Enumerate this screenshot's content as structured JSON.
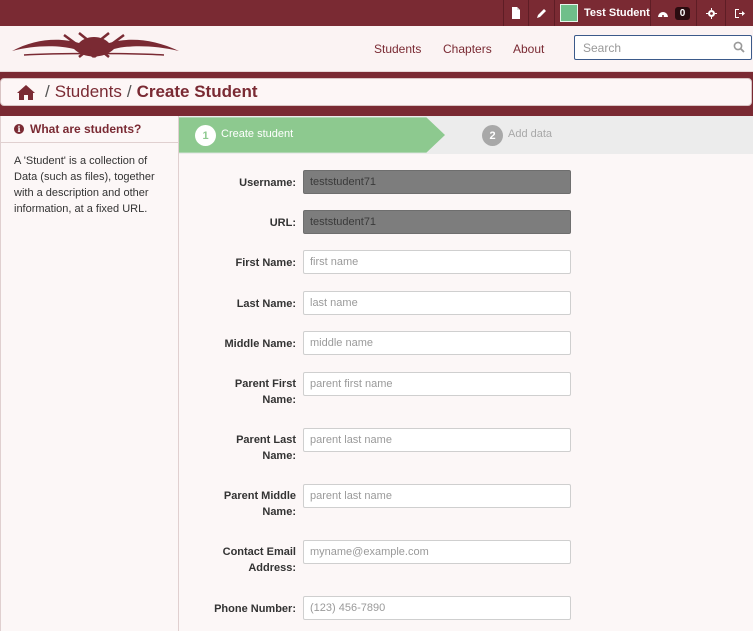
{
  "topbar": {
    "user_name": "Test Student",
    "badge_count": "0",
    "icons": [
      "file-icon",
      "pencil-icon",
      "dashboard-icon",
      "gear-icon",
      "sign-out-icon"
    ]
  },
  "nav": {
    "students": "Students",
    "chapters": "Chapters",
    "about": "About"
  },
  "search": {
    "placeholder": "Search"
  },
  "breadcrumb": {
    "root": "Students",
    "separator": "/",
    "current": "Create Student"
  },
  "sidebar": {
    "title": "What are students?",
    "text": "A 'Student' is a collection of Data (such as files), together with a description and other information, at a fixed URL."
  },
  "steps": [
    {
      "number": "1",
      "label": "Create student",
      "active": true
    },
    {
      "number": "2",
      "label": "Add data",
      "active": false
    }
  ],
  "form": {
    "username": {
      "label": "Username:",
      "value": "teststudent71"
    },
    "url": {
      "label": "URL:",
      "value": "teststudent71"
    },
    "first_name": {
      "label": "First Name:",
      "placeholder": "first name"
    },
    "last_name": {
      "label": "Last Name:",
      "placeholder": "last name"
    },
    "middle_name": {
      "label": "Middle Name:",
      "placeholder": "middle name"
    },
    "parent_first_name": {
      "label": "Parent First Name:",
      "placeholder": "parent first name"
    },
    "parent_last_name": {
      "label": "Parent Last Name:",
      "placeholder": "parent last name"
    },
    "parent_middle_name": {
      "label": "Parent Middle Name:",
      "placeholder": "parent last name"
    },
    "contact_email": {
      "label": "Contact Email Address:",
      "placeholder": "myname@example.com"
    },
    "phone_number": {
      "label": "Phone Number:",
      "placeholder": "(123) 456-7890"
    }
  },
  "colors": {
    "brand": "#7a2a33",
    "step_active": "#8dc98f",
    "step_inactive": "#ececec",
    "input_disabled": "#7d7d7d"
  }
}
